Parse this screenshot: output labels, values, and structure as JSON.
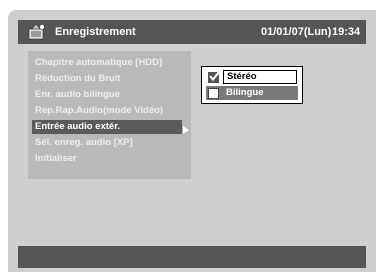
{
  "header": {
    "title": "Enregistrement",
    "date": "01/01/07(Lun)",
    "time": "19:34",
    "icon": "record-settings-icon"
  },
  "menu": {
    "items": [
      {
        "label": "Chapitre automatique [HDD]",
        "state": "disabled"
      },
      {
        "label": "Réduction du Bruit",
        "state": "disabled"
      },
      {
        "label": "Enr. audio bilingue",
        "state": "disabled"
      },
      {
        "label": "Rep.Rap.Audio(mode Vidéo)",
        "state": "disabled"
      },
      {
        "label": "Entrée audio extér.",
        "state": "selected"
      },
      {
        "label": "Sél. enreg. audio [XP]",
        "state": "disabled"
      },
      {
        "label": "Initialiser",
        "state": "disabled"
      }
    ]
  },
  "submenu": {
    "options": [
      {
        "label": "Stéréo",
        "checked": true
      },
      {
        "label": "Bilingue",
        "checked": false
      }
    ]
  },
  "colors": {
    "background": "#cfcfcf",
    "bar": "#555555",
    "selected": "#5a5a5a"
  }
}
